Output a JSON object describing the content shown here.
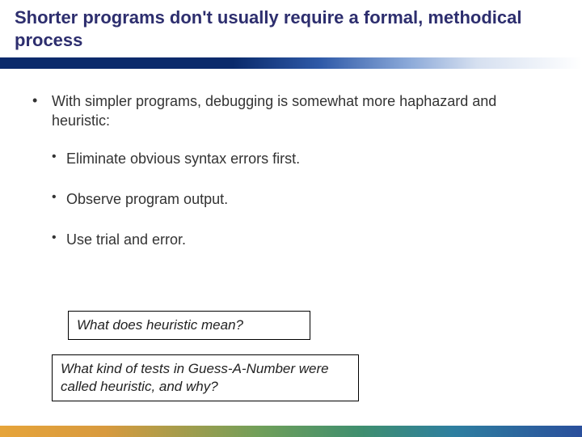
{
  "title": "Shorter programs don't usually require a formal, methodical process",
  "bullets": {
    "main": "With simpler programs, debugging is somewhat more haphazard and heuristic:",
    "sub": [
      "Eliminate obvious syntax errors first.",
      "Observe program output.",
      "Use trial and error."
    ]
  },
  "callouts": {
    "q1": "What does heuristic mean?",
    "q2": "What kind of tests in Guess-A-Number were called heuristic, and why?"
  }
}
